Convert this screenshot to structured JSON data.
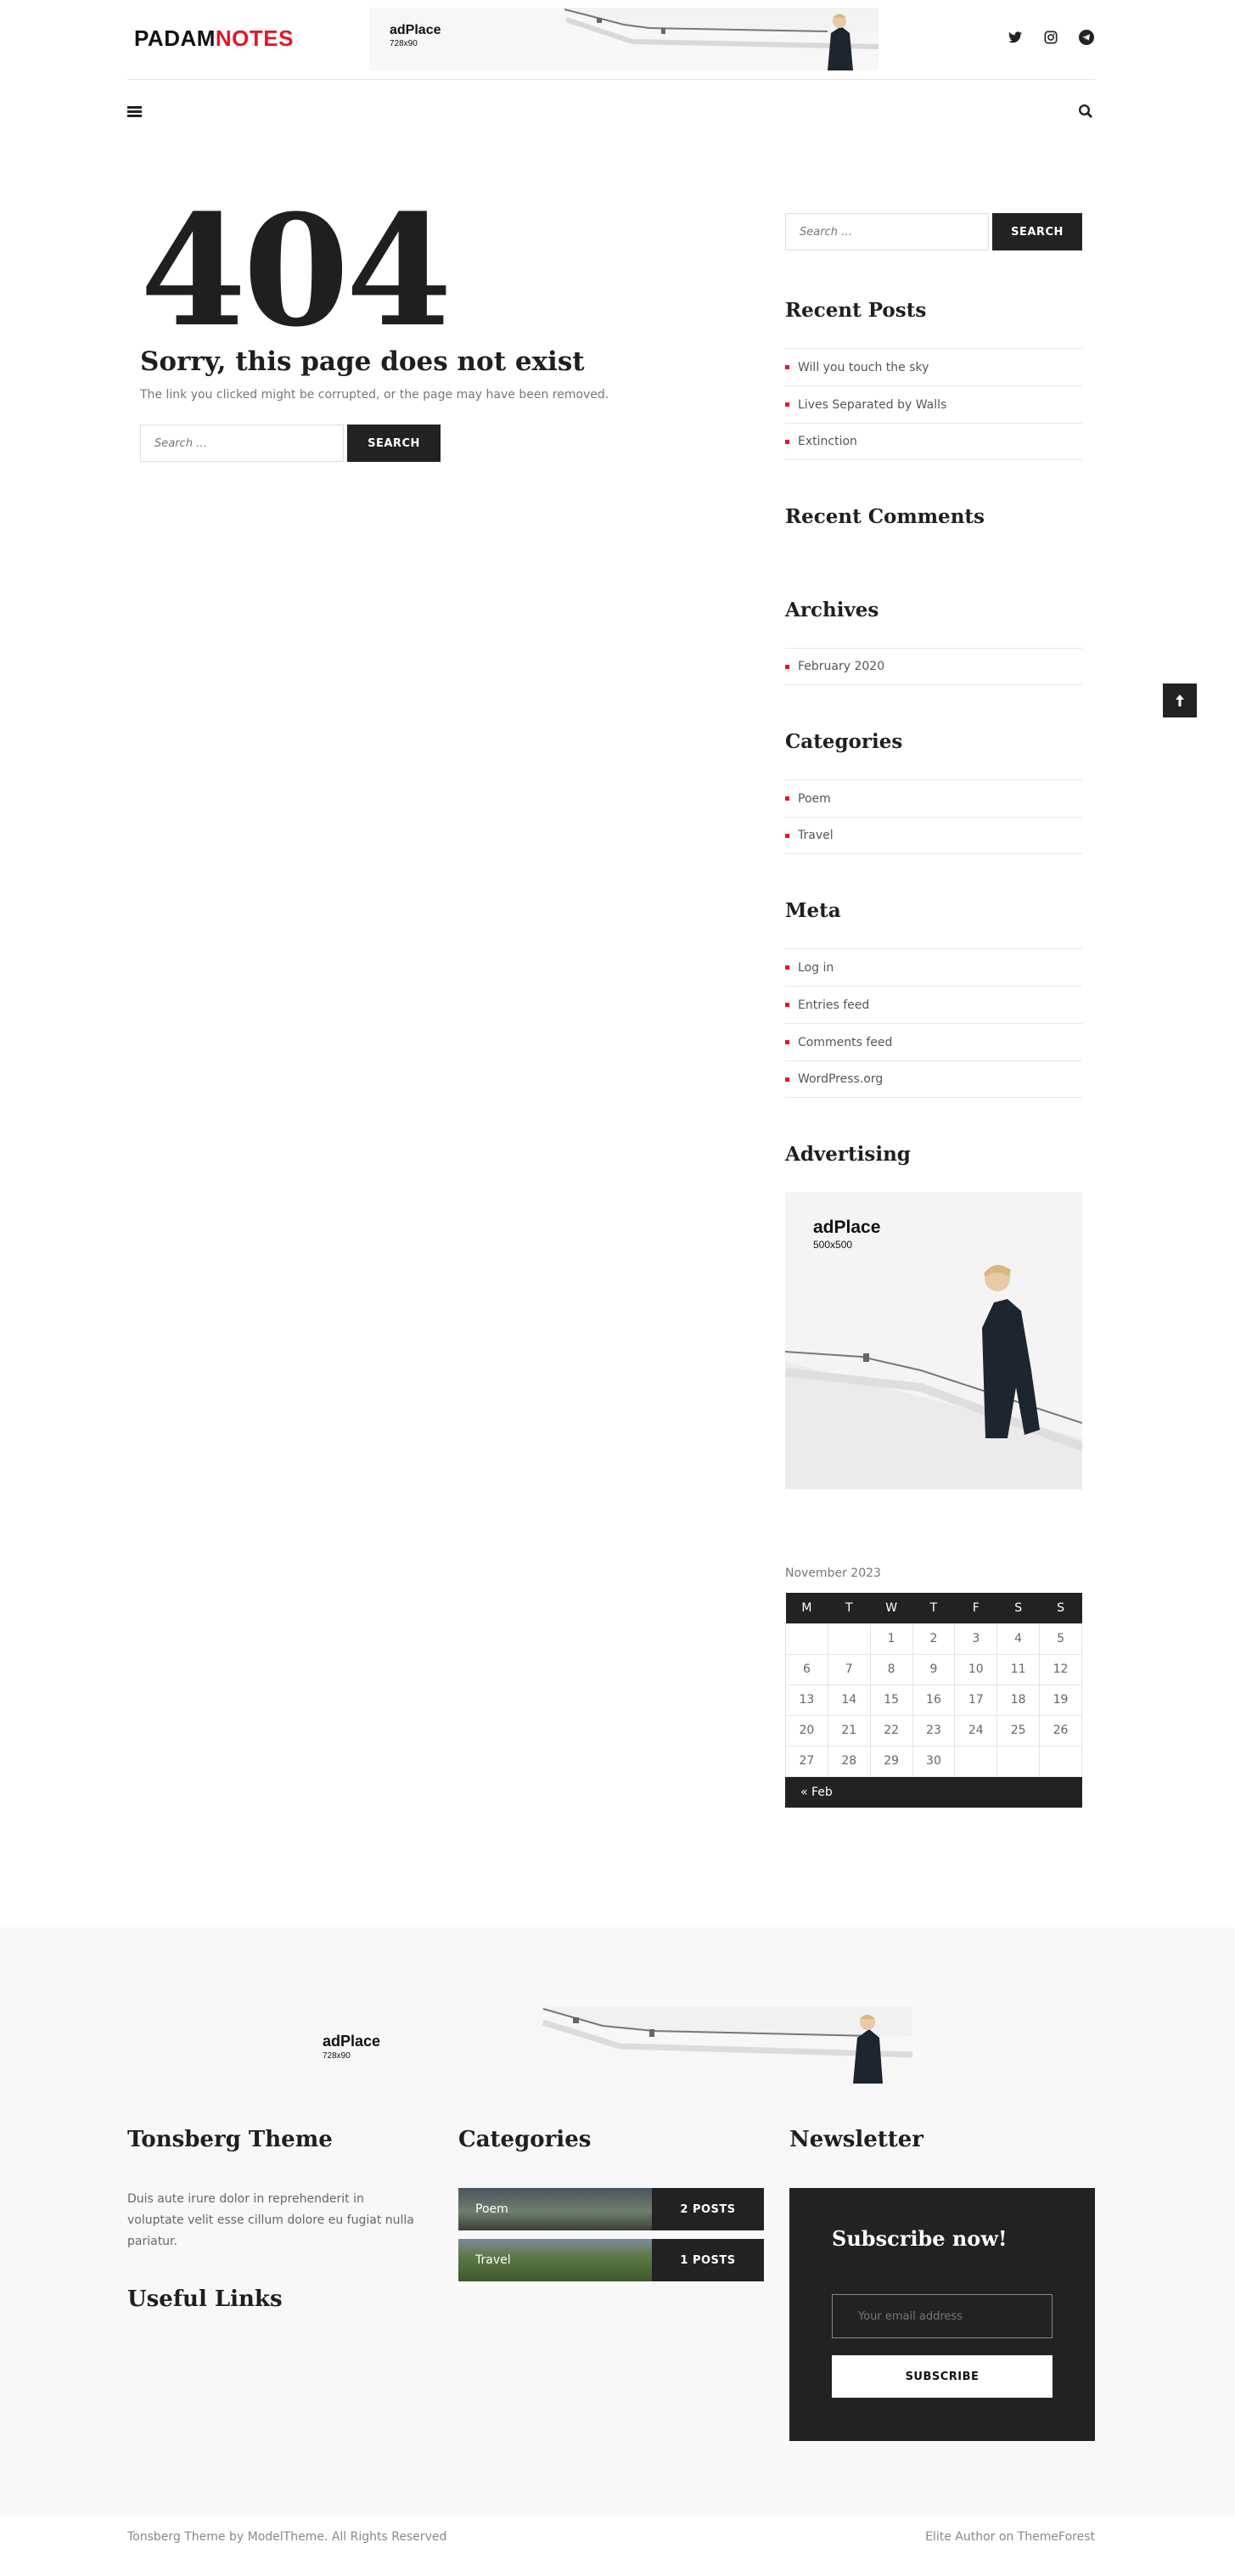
{
  "brand": {
    "part1": "PADAM",
    "part2": "NOTES",
    "accent": "#e4172b"
  },
  "header_ad": {
    "title": "adPlace",
    "size": "728x90"
  },
  "social_icons": [
    "twitter-icon",
    "instagram-icon",
    "telegram-icon"
  ],
  "error": {
    "code": "404",
    "title": "Sorry, this page does not exist",
    "message": "The link you clicked might be corrupted, or the page may have been removed.",
    "search_placeholder": "Search …",
    "search_button": "SEARCH"
  },
  "sidebar": {
    "search_placeholder": "Search …",
    "search_button": "SEARCH",
    "recent_posts": {
      "title": "Recent Posts",
      "items": [
        "Will you touch the sky",
        "Lives Separated by Walls",
        "Extinction"
      ]
    },
    "recent_comments": {
      "title": "Recent Comments"
    },
    "archives": {
      "title": "Archives",
      "items": [
        "February 2020"
      ]
    },
    "categories": {
      "title": "Categories",
      "items": [
        "Poem",
        "Travel"
      ]
    },
    "meta": {
      "title": "Meta",
      "items": [
        "Log in",
        "Entries feed",
        "Comments feed",
        "WordPress.org"
      ]
    },
    "advertising": {
      "title": "Advertising",
      "ad_title": "adPlace",
      "ad_size": "500x500"
    },
    "calendar": {
      "caption": "November 2023",
      "days": [
        "M",
        "T",
        "W",
        "T",
        "F",
        "S",
        "S"
      ],
      "weeks": [
        [
          "",
          "",
          "1",
          "2",
          "3",
          "4",
          "5"
        ],
        [
          "6",
          "7",
          "8",
          "9",
          "10",
          "11",
          "12"
        ],
        [
          "13",
          "14",
          "15",
          "16",
          "17",
          "18",
          "19"
        ],
        [
          "20",
          "21",
          "22",
          "23",
          "24",
          "25",
          "26"
        ],
        [
          "27",
          "28",
          "29",
          "30",
          "",
          "",
          ""
        ]
      ],
      "prev": "« Feb"
    }
  },
  "footer": {
    "ad": {
      "title": "adPlace",
      "size": "728x90"
    },
    "about": {
      "title": "Tonsberg Theme",
      "text": "Duis aute irure dolor in reprehenderit in voluptate velit esse cillum dolore eu fugiat nulla pariatur."
    },
    "useful_links": {
      "title": "Useful Links"
    },
    "categories": {
      "title": "Categories",
      "items": [
        {
          "name": "Poem",
          "count": "2 POSTS"
        },
        {
          "name": "Travel",
          "count": "1 POSTS"
        }
      ]
    },
    "newsletter": {
      "title": "Newsletter",
      "heading": "Subscribe now!",
      "placeholder": "Your email address",
      "button": "SUBSCRIBE"
    },
    "copyright": "Tonsberg Theme by ModelTheme. All Rights Reserved",
    "credit": "Elite Author on ThemeForest"
  }
}
